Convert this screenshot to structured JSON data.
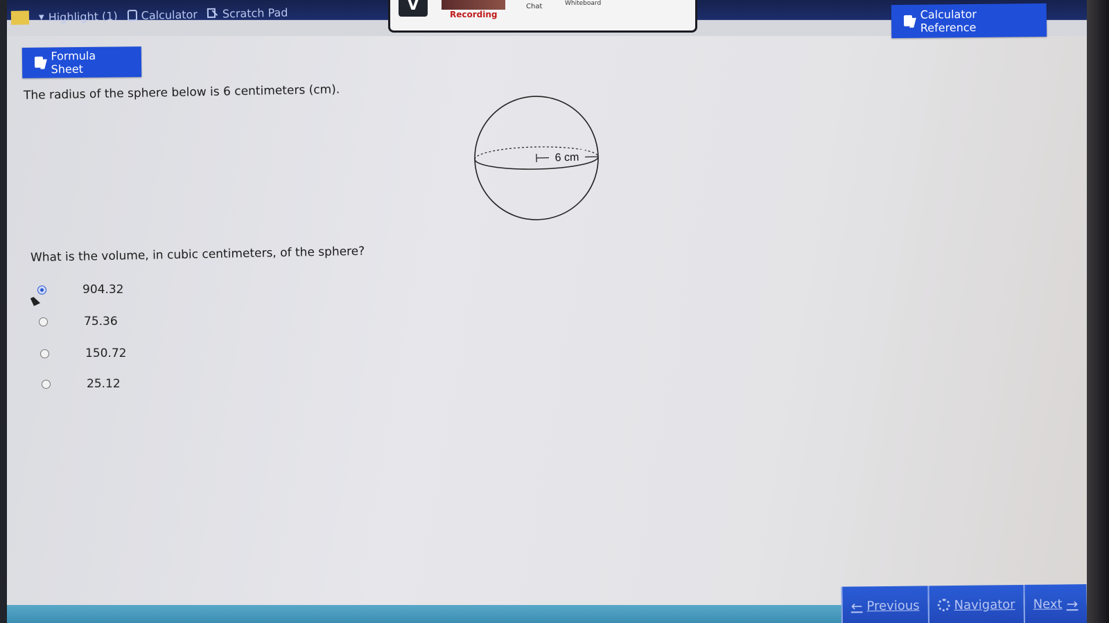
{
  "toolbar": {
    "highlight_label": "Highlight (1)",
    "calculator_label": "Calculator",
    "scratch_pad_label": "Scratch Pad"
  },
  "center_panel": {
    "recording_label": "Recording",
    "chat_label": "Chat",
    "whiteboard_label": "Whiteboard"
  },
  "buttons": {
    "calculator_reference": "Calculator Reference",
    "formula_sheet": "Formula Sheet"
  },
  "question": {
    "text": "The radius of the sphere below is 6 centimeters (cm).",
    "figure_label": "6 cm",
    "prompt": "What is the volume, in cubic centimeters, of the sphere?",
    "choices": [
      {
        "label": "904.32",
        "selected": true
      },
      {
        "label": "75.36",
        "selected": false
      },
      {
        "label": "150.72",
        "selected": false
      },
      {
        "label": "25.12",
        "selected": false
      }
    ]
  },
  "nav": {
    "previous": "Previous",
    "navigator": "Navigator",
    "next": "Next"
  },
  "colors": {
    "accent_blue": "#1f4ed8",
    "selected_radio": "#2a58d6",
    "recording_red": "#c11d1d",
    "highlight_swatch": "#e7c44a"
  }
}
